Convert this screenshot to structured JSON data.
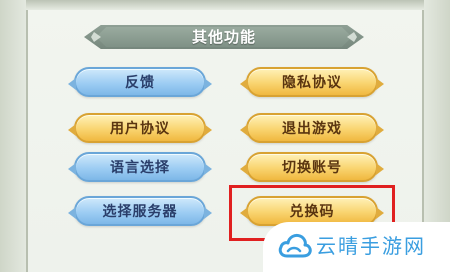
{
  "panel": {
    "title": "其他功能"
  },
  "buttons": {
    "left": [
      {
        "label": "反馈",
        "style": "blue"
      },
      {
        "label": "用户协议",
        "style": "gold"
      },
      {
        "label": "语言选择",
        "style": "blue"
      },
      {
        "label": "选择服务器",
        "style": "blue"
      }
    ],
    "right": [
      {
        "label": "隐私协议",
        "style": "gold"
      },
      {
        "label": "退出游戏",
        "style": "gold"
      },
      {
        "label": "切换账号",
        "style": "gold"
      },
      {
        "label": "兑换码",
        "style": "gold",
        "highlighted": true
      }
    ]
  },
  "watermark": {
    "text": "云晴手游网",
    "color": "#3a9ee0",
    "icon": "cloud-icon"
  },
  "colors": {
    "highlight": "#e02020",
    "blue_button": "#9dcdf3",
    "gold_button": "#f9d470"
  }
}
